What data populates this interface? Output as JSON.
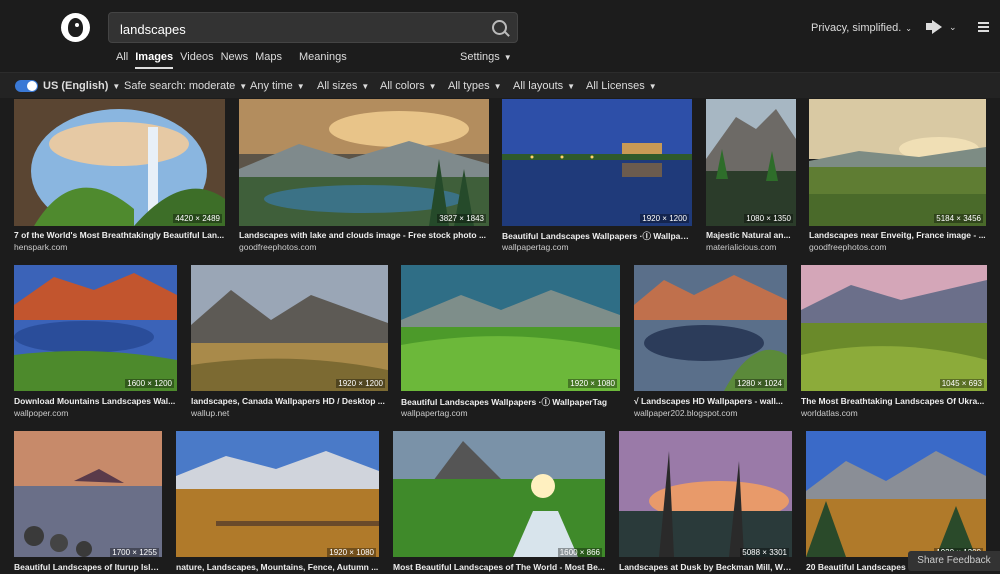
{
  "search": {
    "query": "landscapes"
  },
  "tabs": [
    "All",
    "Images",
    "Videos",
    "News",
    "Maps",
    "Meanings"
  ],
  "settings_label": "Settings",
  "header_right": {
    "privacy_label": "Privacy, simplified."
  },
  "filters": [
    "US (English)",
    "Safe search: moderate",
    "Any time",
    "All sizes",
    "All colors",
    "All types",
    "All layouts",
    "All Licenses"
  ],
  "share_feedback": "Share Feedback",
  "images": [
    {
      "title": "7 of the World's Most Breathtakingly Beautiful Lan...",
      "site": "henspark.com",
      "size": "4420 × 2489"
    },
    {
      "title": "Landscapes with lake and clouds image - Free stock photo ...",
      "site": "goodfreephotos.com",
      "size": "3827 × 1843"
    },
    {
      "title": "Beautiful Landscapes Wallpapers ·Ⓘ Wallpap...",
      "site": "wallpapertag.com",
      "size": "1920 × 1200"
    },
    {
      "title": "Majestic Natural an...",
      "site": "materialicious.com",
      "size": "1080 × 1350"
    },
    {
      "title": "Landscapes near Enveitg, France image - ...",
      "site": "goodfreephotos.com",
      "size": "5184 × 3456"
    },
    {
      "title": "Download Mountains Landscapes Wal...",
      "site": "wallpoper.com",
      "size": "1600 × 1200"
    },
    {
      "title": "landscapes, Canada Wallpapers HD / Desktop ...",
      "site": "wallup.net",
      "size": "1920 × 1200"
    },
    {
      "title": "Beautiful Landscapes Wallpapers ·Ⓘ WallpaperTag",
      "site": "wallpapertag.com",
      "size": "1920 × 1080"
    },
    {
      "title": "√ Landscapes HD Wallpapers - wall...",
      "site": "wallpaper202.blogspot.com",
      "size": "1280 × 1024"
    },
    {
      "title": "The Most Breathtaking Landscapes Of Ukra...",
      "site": "worldatlas.com",
      "size": "1045 × 693"
    },
    {
      "title": "Beautiful Landscapes of Iturup Isla...",
      "site": "",
      "size": "1700 × 1255"
    },
    {
      "title": "nature, Landscapes, Mountains, Fence, Autumn ...",
      "site": "",
      "size": "1920 × 1080"
    },
    {
      "title": "Most Beautiful Landscapes of The World - Most Be...",
      "site": "",
      "size": "1600 × 866"
    },
    {
      "title": "Landscapes at Dusk by Beckman Mill, Wi...",
      "site": "",
      "size": "5088 × 3301"
    },
    {
      "title": "20 Beautiful Landscapes",
      "site": "",
      "size": "1920 × 1200"
    }
  ]
}
